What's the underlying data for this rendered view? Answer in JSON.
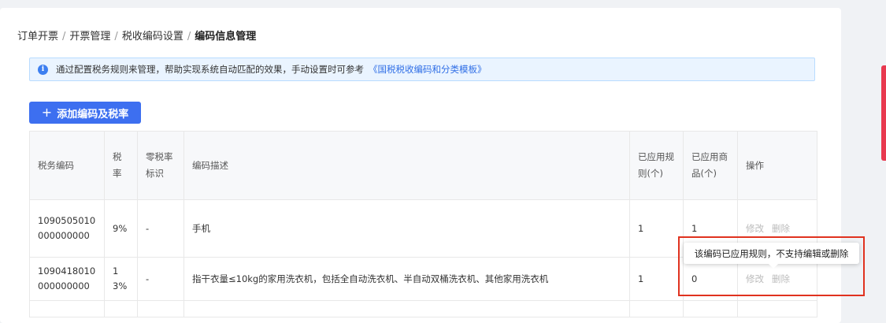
{
  "breadcrumb": {
    "items": [
      "订单开票",
      "开票管理",
      "税收编码设置"
    ],
    "current": "编码信息管理",
    "separator": "/"
  },
  "alert": {
    "icon": "info-icon",
    "text": "通过配置税务规则来管理，帮助实现系统自动匹配的效果，手动设置时可参考",
    "link": "《国税税收编码和分类模板》"
  },
  "toolbar": {
    "add_label": "添加编码及税率",
    "add_icon": "plus-icon"
  },
  "table": {
    "headers": {
      "code": "税务编码",
      "rate": "税率",
      "zero": "零税率标识",
      "desc": "编码描述",
      "rules": "已应用规则(个)",
      "goods": "已应用商品(个)",
      "ops": "操作"
    },
    "rows": [
      {
        "code": "1090505010000000000",
        "rate": "9%",
        "zero": "-",
        "desc": "手机",
        "rules": "1",
        "goods": "1",
        "edit": "修改",
        "delete": "删除"
      },
      {
        "code": "1090418010000000000",
        "rate": "13%",
        "zero": "-",
        "desc": "指干衣量≤10kg的家用洗衣机，包括全自动洗衣机、半自动双桶洗衣机、其他家用洗衣机",
        "rules": "1",
        "goods": "0",
        "edit": "修改",
        "delete": "删除"
      }
    ]
  },
  "tooltip": {
    "text": "该编码已应用规则，不支持编辑或删除"
  },
  "colors": {
    "primary": "#3d6ff0",
    "link": "#2f6ee6",
    "alert_bg": "#eaf4ff",
    "highlight": "#e0321f"
  }
}
